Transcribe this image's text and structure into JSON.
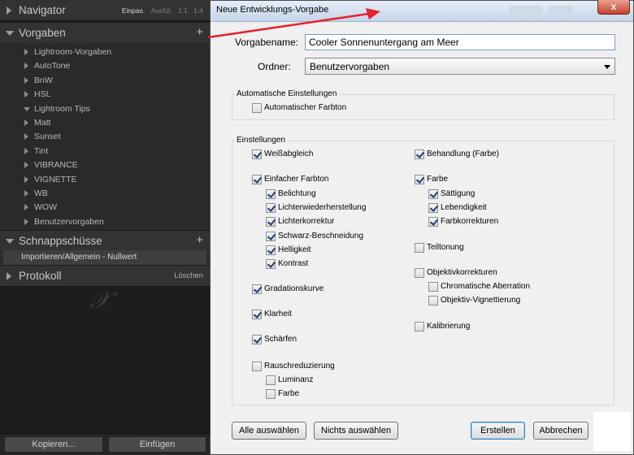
{
  "lightroom": {
    "navigator": {
      "title": "Navigator",
      "opts": [
        "Einpas.",
        "Ausfül.",
        "1:1",
        "1:4"
      ]
    },
    "presets": {
      "title": "Vorgaben",
      "add_label": "+",
      "items": [
        {
          "label": "Lightroom-Vorgaben",
          "open": false
        },
        {
          "label": "AutoTone",
          "open": false
        },
        {
          "label": "BnW",
          "open": false
        },
        {
          "label": "HSL",
          "open": false
        },
        {
          "label": "Lightroom Tips",
          "open": true
        },
        {
          "label": "Matt",
          "open": false
        },
        {
          "label": "Sunset",
          "open": false
        },
        {
          "label": "Tint",
          "open": false
        },
        {
          "label": "VIBRANCE",
          "open": false
        },
        {
          "label": "VIGNETTE",
          "open": false
        },
        {
          "label": "WB",
          "open": false
        },
        {
          "label": "WOW",
          "open": false
        },
        {
          "label": "Benutzervorgaben",
          "open": false
        }
      ]
    },
    "snapshots": {
      "title": "Schnappschüsse",
      "add_label": "+",
      "item": "Importieren/Allgemein - Nullwert"
    },
    "history": {
      "title": "Protokoll",
      "clear_label": "Löschen"
    },
    "logo": "𝒳",
    "buttons": {
      "copy": "Kopieren...",
      "paste": "Einfügen"
    }
  },
  "dialog": {
    "title": "Neue Entwicklungs-Vorgabe",
    "close_label": "x",
    "name_label": "Vorgabename:",
    "name_value": "Cooler Sonnenuntergang am Meer",
    "folder_label": "Ordner:",
    "folder_value": "Benutzervorgaben",
    "auto_group": {
      "legend": "Automatische Einstellungen",
      "auto_tone": {
        "label": "Automatischer Farbton",
        "checked": false
      }
    },
    "settings": {
      "legend": "Einstellungen",
      "left": [
        {
          "label": "Weißabgleich",
          "checked": true,
          "indent": 0
        },
        {
          "label": "Einfacher Farbton",
          "checked": true,
          "indent": 0
        },
        {
          "label": "Belichtung",
          "checked": true,
          "indent": 1
        },
        {
          "label": "Lichterwiederherstellung",
          "checked": true,
          "indent": 1
        },
        {
          "label": "Lichterkorrektur",
          "checked": true,
          "indent": 1
        },
        {
          "label": "Schwarz-Beschneidung",
          "checked": true,
          "indent": 1
        },
        {
          "label": "Helligkeit",
          "checked": true,
          "indent": 1
        },
        {
          "label": "Kontrast",
          "checked": true,
          "indent": 1
        },
        {
          "label": "Gradationskurve",
          "checked": true,
          "indent": 0
        },
        {
          "label": "Klarheit",
          "checked": true,
          "indent": 0
        },
        {
          "label": "Schärfen",
          "checked": true,
          "indent": 0
        },
        {
          "label": "Rauschreduzierung",
          "checked": false,
          "indent": 0
        },
        {
          "label": "Luminanz",
          "checked": false,
          "indent": 1
        },
        {
          "label": "Farbe",
          "checked": false,
          "indent": 1
        }
      ],
      "right": [
        {
          "label": "Behandlung (Farbe)",
          "checked": true,
          "indent": 0
        },
        {
          "label": "Farbe",
          "checked": true,
          "indent": 0
        },
        {
          "label": "Sättigung",
          "checked": true,
          "indent": 1
        },
        {
          "label": "Lebendigkeit",
          "checked": true,
          "indent": 1
        },
        {
          "label": "Farbkorrekturen",
          "checked": true,
          "indent": 1
        },
        {
          "label": "Teiltonung",
          "checked": false,
          "indent": 0
        },
        {
          "label": "Objektivkorrekturen",
          "checked": false,
          "indent": 0
        },
        {
          "label": "Chromatische Aberration",
          "checked": false,
          "indent": 1
        },
        {
          "label": "Objektiv-Vignettierung",
          "checked": false,
          "indent": 1
        },
        {
          "label": "Kalibrierung",
          "checked": false,
          "indent": 0
        }
      ]
    },
    "buttons": {
      "select_all": "Alle auswählen",
      "select_none": "Nichts auswählen",
      "create": "Erstellen",
      "cancel": "Abbrechen"
    }
  },
  "colors": {
    "arrow": "#e8202a",
    "panel_bg": "#1d1d1d",
    "dialog_bg": "#f0f0f0"
  }
}
